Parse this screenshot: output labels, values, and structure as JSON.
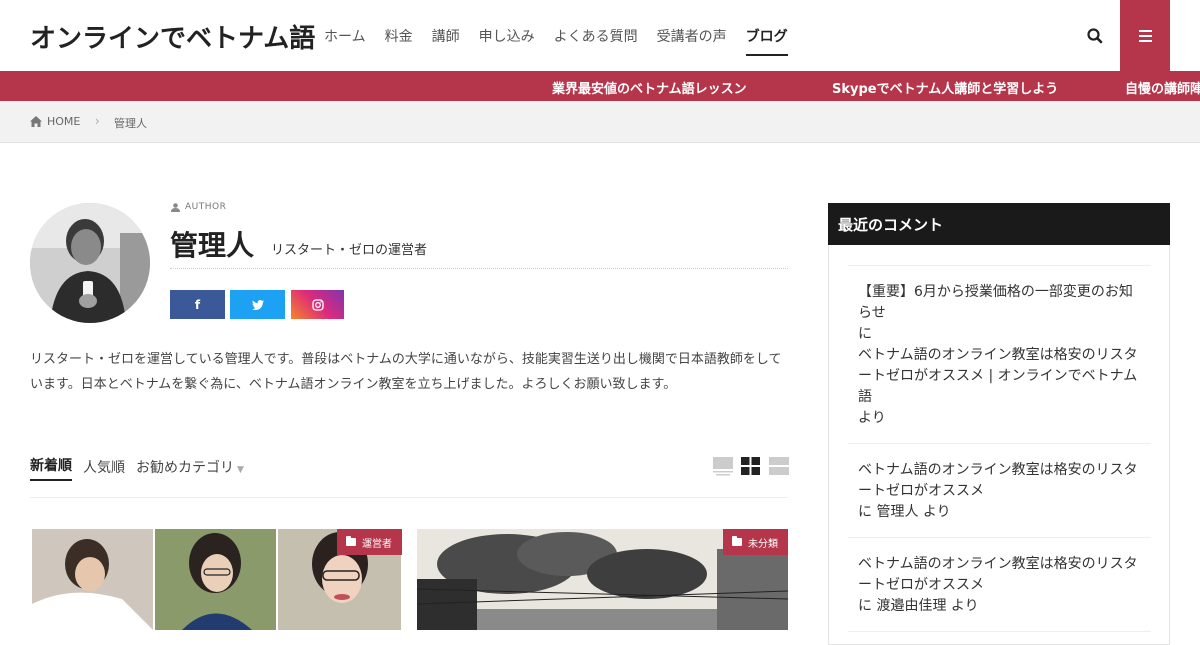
{
  "header": {
    "logo": "オンラインでベトナム語",
    "nav": [
      {
        "label": "ホーム"
      },
      {
        "label": "料金"
      },
      {
        "label": "講師"
      },
      {
        "label": "申し込み"
      },
      {
        "label": "よくある質問"
      },
      {
        "label": "受講者の声"
      },
      {
        "label": "ブログ",
        "active": true
      }
    ],
    "search_icon": "search-icon",
    "menu_icon": "hamburger-menu-icon"
  },
  "ticker": {
    "items": [
      "業界最安値のベトナム語レッスン",
      "Skypeでベトナム人講師と学習しよう",
      "自慢の講師陣"
    ]
  },
  "breadcrumb": {
    "home": "HOME",
    "current": "管理人"
  },
  "author": {
    "tag": "AUTHOR",
    "name": "管理人",
    "role": "リスタート・ゼロの運営者",
    "sns": {
      "facebook": "f",
      "twitter": "twitter-icon",
      "instagram": "instagram-icon"
    },
    "description": "リスタート・ゼロを運営している管理人です。普段はベトナムの大学に通いながら、技能実習生送り出し機関で日本語教師をしています。日本とベトナムを繋ぐ為に、ベトナム語オンライン教室を立ち上げました。よろしくお願い致します。"
  },
  "tabs": {
    "items": [
      {
        "label": "新着順",
        "active": true
      },
      {
        "label": "人気順"
      },
      {
        "label": "お勧めカテゴリ"
      }
    ],
    "view_icons": [
      "large-view-icon",
      "grid-view-icon",
      "list-view-icon"
    ]
  },
  "cards": [
    {
      "category": "運営者"
    },
    {
      "category": "未分類"
    }
  ],
  "sidebar": {
    "title": "最近のコメント",
    "comments": [
      {
        "lines": [
          "【重要】6月から授業価格の一部変更のお知",
          "らせ",
          "に",
          "ベトナム語のオンライン教室は格安のリスタ",
          "ートゼロがオススメ | オンラインでベトナム",
          "語",
          "より"
        ]
      },
      {
        "lines": [
          "ベトナム語のオンライン教室は格安のリスタ",
          "ートゼロがオススメ",
          "に 管理人 より"
        ]
      },
      {
        "lines": [
          "ベトナム語のオンライン教室は格安のリスタ",
          "ートゼロがオススメ",
          "に 渡邉由佳理 より"
        ]
      }
    ]
  }
}
